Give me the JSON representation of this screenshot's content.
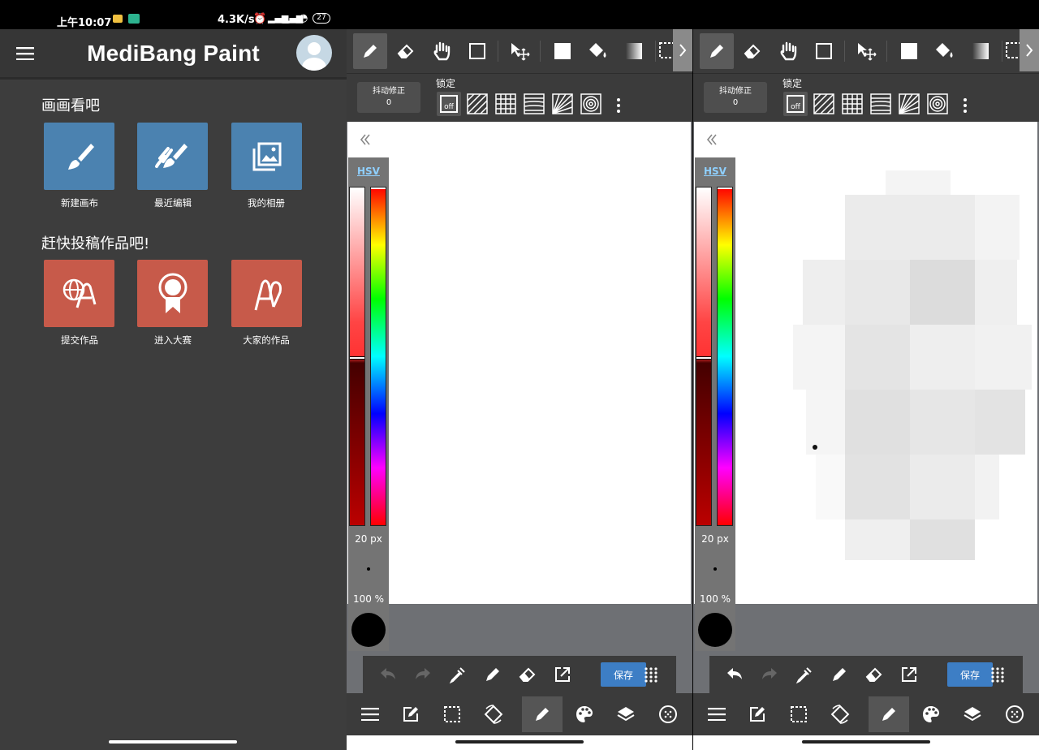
{
  "status": {
    "time": "上午10:07",
    "speed": "4.3K/s",
    "battery": "27"
  },
  "home": {
    "app_title": "MediBang Paint",
    "section1": "画画看吧",
    "section2": "赶快投稿作品吧!",
    "tiles1": [
      {
        "label": "新建画布",
        "icon": "brush-icon"
      },
      {
        "label": "最近编辑",
        "icon": "brushes-icon"
      },
      {
        "label": "我的相册",
        "icon": "gallery-icon"
      }
    ],
    "tiles2": [
      {
        "label": "提交作品",
        "icon": "globe-clip-icon"
      },
      {
        "label": "进入大赛",
        "icon": "award-ribbon-icon"
      },
      {
        "label": "大家的作品",
        "icon": "clip-icon"
      }
    ]
  },
  "editor": {
    "tools": [
      "pen-icon",
      "eraser-icon",
      "hand-icon",
      "rectangle-icon",
      "move-icon",
      "fill-square-icon",
      "bucket-icon",
      "gradient-icon",
      "select-icon"
    ],
    "stabilizer_label": "抖动修正",
    "stabilizer_value": "0",
    "lock_label": "锁定",
    "lock_off": "off",
    "lock_options": [
      "off",
      "parallel-lines-icon",
      "grid-icon",
      "perspective-lines-icon",
      "radial-lines-icon",
      "concentric-icon"
    ],
    "color_mode": "HSV",
    "brush_size": "20 px",
    "opacity": "100 %",
    "save_label": "保存",
    "action_icons": [
      "undo-icon",
      "redo-icon",
      "eyedropper-icon",
      "pen-icon",
      "eraser-icon",
      "external-icon",
      "save",
      "grid-dots-icon"
    ],
    "bottom_icons": [
      "menu-icon",
      "edit-icon",
      "selection-icon",
      "rotate-icon",
      "brush-icon",
      "palette-icon",
      "layers-icon",
      "materials-icon"
    ],
    "colors": {
      "accent": "#3d7ec5",
      "toolbar": "#3b3b3b",
      "canvas": "#ffffff",
      "palette_bg": "#747474"
    }
  }
}
